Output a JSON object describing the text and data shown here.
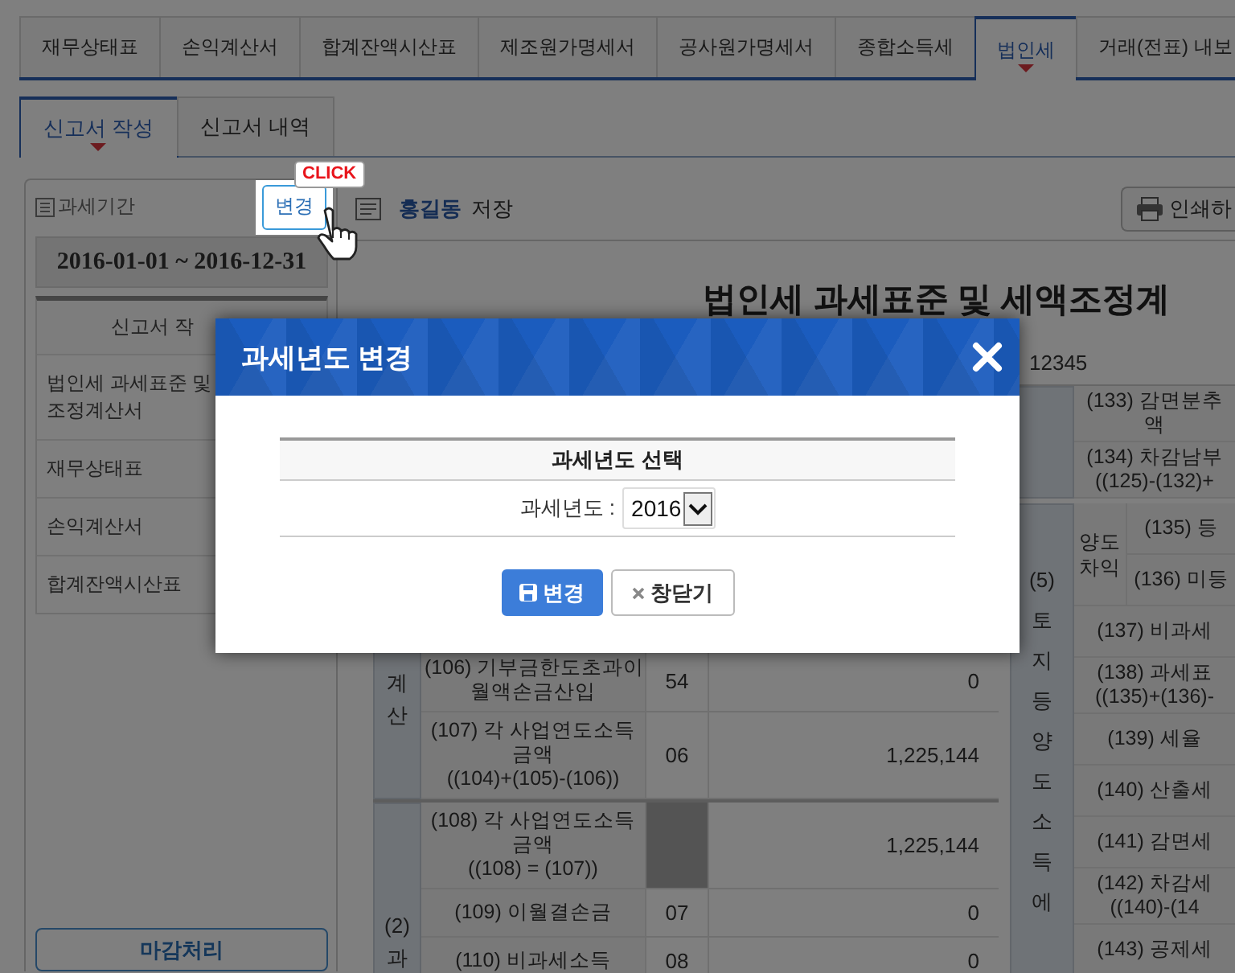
{
  "main_tabs": [
    {
      "label": "재무상태표",
      "selected": false
    },
    {
      "label": "손익계산서",
      "selected": false
    },
    {
      "label": "합계잔액시산표",
      "selected": false
    },
    {
      "label": "제조원가명세서",
      "selected": false
    },
    {
      "label": "공사원가명세서",
      "selected": false
    },
    {
      "label": "종합소득세",
      "selected": false
    },
    {
      "label": "법인세",
      "selected": true
    },
    {
      "label": "거래(전표) 내보",
      "selected": false
    }
  ],
  "sub_tabs": [
    {
      "label": "신고서 작성",
      "selected": true
    },
    {
      "label": "신고서 내역",
      "selected": false
    }
  ],
  "sidebar": {
    "period_label": "과세기간",
    "change_button": "변경",
    "click_badge": "CLICK",
    "period": "2016-01-01 ~ 2016-12-31",
    "list_header": "신고서 작",
    "items": [
      {
        "lines": [
          "법인세 과세표준 및",
          "조정계산서"
        ]
      },
      {
        "lines": [
          "재무상태표"
        ]
      },
      {
        "lines": [
          "손익계산서"
        ]
      },
      {
        "lines": [
          "합계잔액시산표"
        ]
      }
    ],
    "close_button": "마감처리"
  },
  "toolbar": {
    "user": "홍길동",
    "save": "저장",
    "print_button": "인쇄하"
  },
  "document": {
    "title": "법인세 과세표준 및 세액조정계",
    "id_text": "12345",
    "left_table": {
      "groups": [
        {
          "label": "계산",
          "rows": [
            {
              "label": [
                "(106) 기부금한도초과이",
                "월액손금산입"
              ],
              "code": "54",
              "code_shaded": false,
              "value": "0"
            },
            {
              "label": [
                "(107) 각 사업연도소득",
                "금액",
                "((104)+(105)-(106))"
              ],
              "code": "06",
              "code_shaded": false,
              "value": "1,225,144"
            }
          ]
        },
        {
          "label": "(2)과",
          "rows": [
            {
              "label": [
                "(108) 각 사업연도소득",
                "금액",
                "((108) = (107))"
              ],
              "code_shaded": true,
              "value": "1,225,144"
            },
            {
              "label": [
                "(109) 이월결손금"
              ],
              "code": "07",
              "code_shaded": false,
              "value": "0"
            },
            {
              "label": [
                "(110) 비과세소득"
              ],
              "code": "08",
              "code_shaded": false,
              "value": "0"
            }
          ]
        }
      ]
    },
    "right_table": {
      "groups": [
        {
          "rows": [
            {
              "kind": "row",
              "label": [
                "(133) 감면분추",
                "액"
              ]
            },
            {
              "kind": "row",
              "label": [
                "(134) 차감남부",
                "((125)-(132)+"
              ]
            }
          ]
        },
        {
          "label": "(5)토지등양도소득에",
          "rows": [
            {
              "kind": "subgroup",
              "label": "양도차익",
              "rows": [
                {
                  "label": [
                    "(135) 등"
                  ]
                },
                {
                  "label": [
                    "(136) 미등"
                  ]
                }
              ]
            },
            {
              "kind": "row",
              "label": [
                "(137) 비과세"
              ]
            },
            {
              "kind": "row",
              "label": [
                "(138) 과세표",
                "((135)+(136)-"
              ]
            },
            {
              "kind": "row",
              "label": [
                "(139) 세율"
              ]
            },
            {
              "kind": "row",
              "label": [
                "(140) 산출세"
              ]
            },
            {
              "kind": "row",
              "label": [
                "(141) 감면세"
              ]
            },
            {
              "kind": "row",
              "label": [
                "(142) 차감세",
                "((140)-(14"
              ]
            },
            {
              "kind": "row",
              "label": [
                "(143) 공제세"
              ]
            }
          ]
        }
      ]
    }
  },
  "dialog": {
    "title": "과세년도 변경",
    "table_header": "과세년도 선택",
    "year_label": "과세년도 :",
    "year_value": "2016",
    "save_button": "변경",
    "close_button": "창닫기"
  }
}
